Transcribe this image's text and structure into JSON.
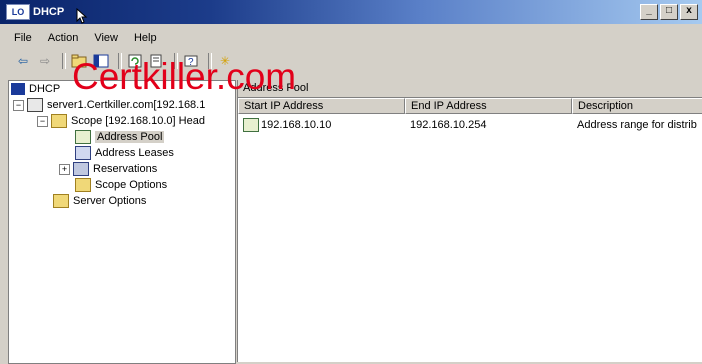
{
  "window": {
    "title": "DHCP",
    "icon_label": "LO"
  },
  "title_buttons": {
    "minimize": "_",
    "maximize": "□",
    "close": "x"
  },
  "menu": [
    "File",
    "Action",
    "View",
    "Help"
  ],
  "watermark": "Certkiller.com",
  "tree": {
    "root": "DHCP",
    "server": "server1.Certkiller.com[192.168.1",
    "scope": "Scope [192.168.10.0] Head",
    "address_pool": "Address Pool",
    "address_leases": "Address Leases",
    "reservations": "Reservations",
    "scope_options": "Scope Options",
    "server_options": "Server Options"
  },
  "right": {
    "title": "Address Pool",
    "columns": [
      "Start IP Address",
      "End IP Address",
      "Description"
    ],
    "rows": [
      {
        "start": "192.168.10.10",
        "end": "192.168.10.254",
        "description": "Address range for distrib"
      }
    ]
  }
}
